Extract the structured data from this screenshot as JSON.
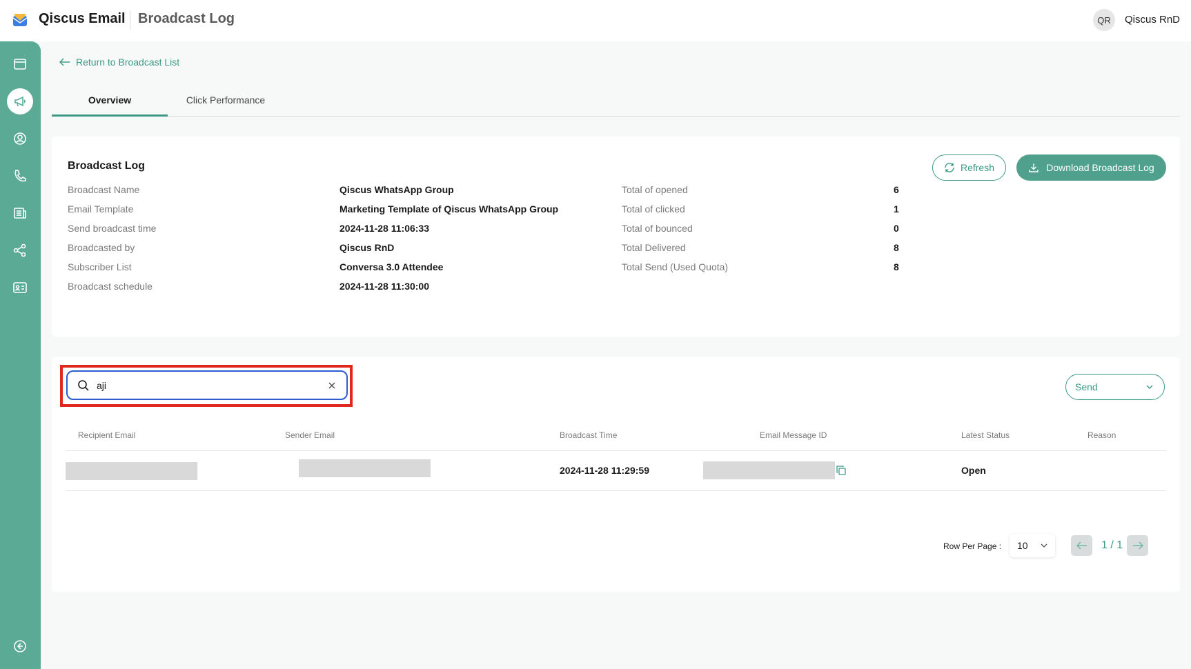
{
  "header": {
    "app_name": "Qiscus Email",
    "page_title": "Broadcast Log",
    "user_initials": "QR",
    "user_name": "Qiscus RnD"
  },
  "sidebar": {
    "items": [
      {
        "icon": "calendar-window-icon",
        "active": false
      },
      {
        "icon": "megaphone-icon",
        "active": true
      },
      {
        "icon": "user-circle-icon",
        "active": false
      },
      {
        "icon": "phone-icon",
        "active": false
      },
      {
        "icon": "newspaper-icon",
        "active": false
      },
      {
        "icon": "share-nodes-icon",
        "active": false
      },
      {
        "icon": "contact-card-icon",
        "active": false
      }
    ],
    "collapse_icon": "collapse-arrow-icon"
  },
  "nav": {
    "return_label": "Return to Broadcast List",
    "tabs": [
      {
        "label": "Overview",
        "active": true
      },
      {
        "label": "Click Performance",
        "active": false
      }
    ]
  },
  "summary": {
    "title": "Broadcast Log",
    "refresh_label": "Refresh",
    "download_label": "Download Broadcast Log",
    "left_fields": [
      {
        "label": "Broadcast Name",
        "value": "Qiscus WhatsApp Group"
      },
      {
        "label": "Email Template",
        "value": "Marketing Template of Qiscus WhatsApp Group"
      },
      {
        "label": "Send broadcast time",
        "value": "2024-11-28 11:06:33"
      },
      {
        "label": "Broadcasted by",
        "value": "Qiscus RnD"
      },
      {
        "label": "Subscriber List",
        "value": "Conversa 3.0 Attendee"
      },
      {
        "label": "Broadcast schedule",
        "value": "2024-11-28 11:30:00"
      }
    ],
    "right_fields": [
      {
        "label": "Total of opened",
        "value": "6"
      },
      {
        "label": "Total of clicked",
        "value": "1"
      },
      {
        "label": "Total of bounced",
        "value": "0"
      },
      {
        "label": "Total Delivered",
        "value": "8"
      },
      {
        "label": "Total Send (Used Quota)",
        "value": "8"
      }
    ]
  },
  "log": {
    "search_value": "aji",
    "status_filter": "Send",
    "columns": [
      "Recipient Email",
      "Sender Email",
      "Broadcast Time",
      "Email Message ID",
      "Latest Status",
      "Reason"
    ],
    "rows": [
      {
        "recipient_email": "",
        "sender_email": "",
        "broadcast_time": "2024-11-28 11:29:59",
        "message_id": "",
        "latest_status": "Open",
        "reason": ""
      }
    ],
    "rows_per_page_label": "Row Per Page :",
    "rows_per_page": "10",
    "page_indicator": "1 / 1"
  },
  "colors": {
    "accent": "#3a9a84",
    "sidebar": "#5aaa96",
    "highlight": "#e0281e",
    "focus": "#2d5bd0"
  }
}
